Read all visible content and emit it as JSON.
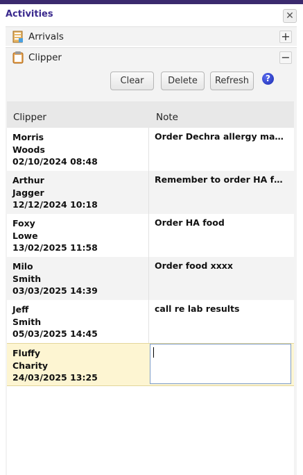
{
  "header": {
    "title": "Activities",
    "close_glyph": "✕"
  },
  "sections": {
    "arrivals": {
      "label": "Arrivals",
      "toggle": "+",
      "icon": "arrivals-book-icon"
    },
    "clipper": {
      "label": "Clipper",
      "toggle": "−",
      "icon": "clipboard-icon"
    }
  },
  "toolbar": {
    "clear_label": "Clear",
    "delete_label": "Delete",
    "refresh_label": "Refresh",
    "help_glyph": "?"
  },
  "table": {
    "columns": [
      "Clipper",
      "Note"
    ],
    "rows": [
      {
        "first": "Morris",
        "last": "Woods",
        "datetime": "02/10/2024 08:48",
        "note": "Order Dechra allergy manag..."
      },
      {
        "first": "Arthur",
        "last": "Jagger",
        "datetime": "12/12/2024 10:18",
        "note": "Remember to order HA food"
      },
      {
        "first": "Foxy",
        "last": "Lowe",
        "datetime": "13/02/2025 11:58",
        "note": "Order HA food"
      },
      {
        "first": "Milo",
        "last": "Smith",
        "datetime": "03/03/2025 14:39",
        "note": "Order food xxxx"
      },
      {
        "first": "Jeff",
        "last": "Smith",
        "datetime": "05/03/2025 14:45",
        "note": "call re lab results"
      },
      {
        "first": "Fluffy",
        "last": "Charity",
        "datetime": "24/03/2025 13:25",
        "note": ""
      }
    ]
  },
  "colors": {
    "accent": "#3b2a8e",
    "selected_row": "#fdf5d2",
    "alt_row": "#f3f3f3"
  }
}
